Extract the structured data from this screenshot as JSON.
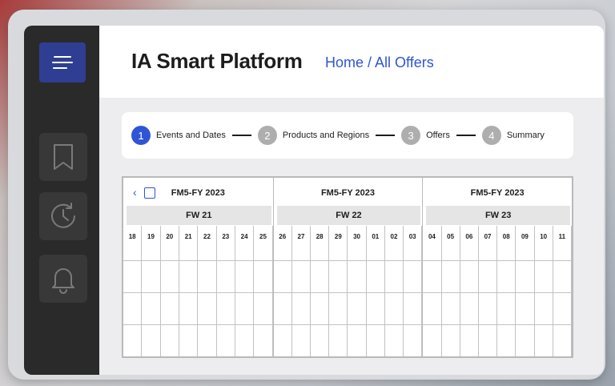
{
  "app": {
    "title": "IA Smart Platform",
    "breadcrumb": "Home / All Offers"
  },
  "sidebar": {
    "items": [
      {
        "icon": "menu-icon"
      },
      {
        "icon": "bookmark-icon"
      },
      {
        "icon": "history-icon"
      },
      {
        "icon": "bell-icon"
      }
    ]
  },
  "stepper": {
    "steps": [
      {
        "num": "1",
        "label": "Events and Dates",
        "active": true
      },
      {
        "num": "2",
        "label": "Products and Regions",
        "active": false
      },
      {
        "num": "3",
        "label": "Offers",
        "active": false
      },
      {
        "num": "4",
        "label": "Summary",
        "active": false
      }
    ]
  },
  "calendar": {
    "nav_prev": "‹",
    "sections": [
      {
        "title": "FM5-FY 2023",
        "week": "FW 21",
        "days": [
          "18",
          "19",
          "20",
          "21",
          "22",
          "23",
          "24",
          "25"
        ]
      },
      {
        "title": "FM5-FY 2023",
        "week": "FW 22",
        "days": [
          "26",
          "27",
          "28",
          "29",
          "30",
          "01",
          "02",
          "03"
        ]
      },
      {
        "title": "FM5-FY 2023",
        "week": "FW 23",
        "days": [
          "04",
          "05",
          "06",
          "07",
          "08",
          "09",
          "10",
          "11"
        ]
      }
    ]
  },
  "colors": {
    "accent": "#2f55d4",
    "sidebar_bg": "#2a2a2a",
    "menu_btn": "#2f3e93",
    "inactive_step": "#aeaeae"
  }
}
